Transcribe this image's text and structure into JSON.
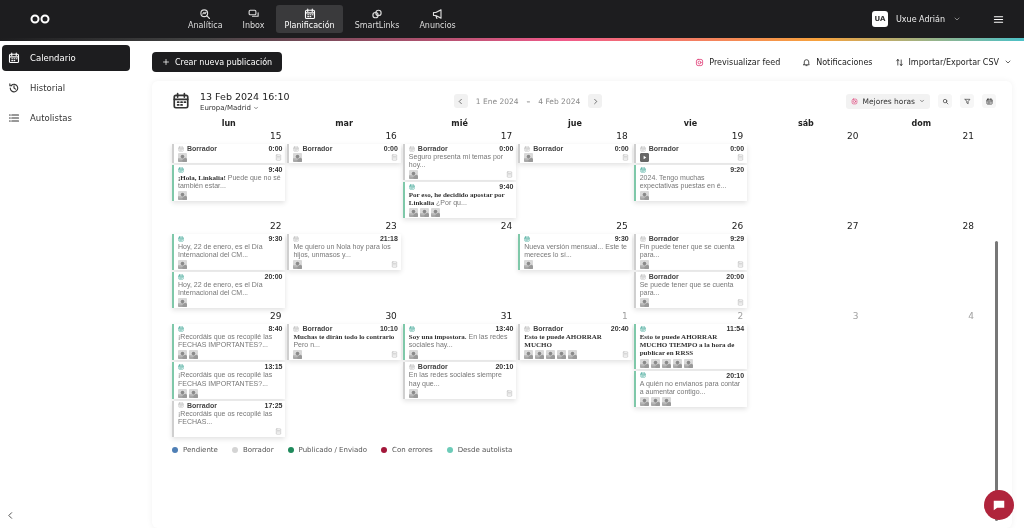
{
  "nav": {
    "tabs": [
      {
        "label": "Analítica",
        "selected": false
      },
      {
        "label": "Inbox",
        "selected": false
      },
      {
        "label": "Planificación",
        "selected": true
      },
      {
        "label": "SmartLinks",
        "selected": false
      },
      {
        "label": "Anuncios",
        "selected": false
      }
    ],
    "user": {
      "initials": "UA",
      "name": "Uxue Adrián"
    }
  },
  "sidebar": {
    "items": [
      {
        "label": "Calendario",
        "selected": true
      },
      {
        "label": "Historial",
        "selected": false
      },
      {
        "label": "Autolistas",
        "selected": false
      }
    ]
  },
  "toolbar": {
    "create_button": "Crear nueva publicación",
    "actions": [
      "Previsualizar feed",
      "Notificaciones",
      "Importar/Exportar CSV"
    ]
  },
  "calendar": {
    "datetime": "13 Feb 2024 16:10",
    "timezone": "Europa/Madrid",
    "range_start": "1 Ene 2024",
    "range_sep": "–",
    "range_end": "4 Feb 2024",
    "best_hours": "Mejores horas",
    "weekdays": [
      "lun",
      "mar",
      "mié",
      "jue",
      "vie",
      "sáb",
      "dom"
    ],
    "weeks": [
      {
        "days": [
          {
            "number": "15",
            "other_month": false,
            "posts": [
              {
                "time": "0:00",
                "kind": "draft",
                "label": "Borrador"
              },
              {
                "time": "9:40",
                "kind": "published",
                "text": "**¡Hola, Linkalia!** Puede que no sé también estar..."
              }
            ]
          },
          {
            "number": "16",
            "other_month": false,
            "posts": [
              {
                "time": "0:00",
                "kind": "draft",
                "label": "Borrador"
              }
            ]
          },
          {
            "number": "17",
            "other_month": false,
            "posts": [
              {
                "time": "0:00",
                "kind": "draft",
                "label": "Borrador",
                "text": "Seguro presenta mi temas por hoy..."
              },
              {
                "time": "9:40",
                "kind": "published",
                "text": "**Por eso, he decidido apostar por Linkalia** ¿Por qu..."
              }
            ]
          },
          {
            "number": "18",
            "other_month": false,
            "posts": [
              {
                "time": "0:00",
                "kind": "draft",
                "label": "Borrador"
              }
            ]
          },
          {
            "number": "19",
            "other_month": false,
            "posts": [
              {
                "time": "0:00",
                "kind": "draft",
                "label": "Borrador",
                "media": [
                  {
                    "kind": "video"
                  }
                ]
              },
              {
                "time": "9:20",
                "kind": "published",
                "text": "2024. Tengo muchas expectativas puestas en é..."
              }
            ]
          },
          {
            "number": "20",
            "other_month": false
          },
          {
            "number": "21",
            "other_month": false
          }
        ]
      },
      {
        "days": [
          {
            "number": "22",
            "other_month": false,
            "posts": [
              {
                "time": "9:30",
                "kind": "published",
                "text": "Hoy, 22 de enero, es el Día Internacional del CM..."
              },
              {
                "time": "20:00",
                "kind": "published",
                "text": "Hoy, 22 de enero, es el Día Internacional del CM..."
              }
            ]
          },
          {
            "number": "23",
            "other_month": false,
            "posts": [
              {
                "time": "21:18",
                "kind": "draft",
                "text": "Me quiero un Nola hoy para los hijos, unmasos y..."
              }
            ]
          },
          {
            "number": "24",
            "other_month": false
          },
          {
            "number": "25",
            "other_month": false,
            "posts": [
              {
                "time": "9:30",
                "kind": "published",
                "text": "Nueva versión mensual... Este te mereces lo sí..."
              }
            ]
          },
          {
            "number": "26",
            "other_month": false,
            "posts": [
              {
                "time": "9:29",
                "kind": "draft",
                "label": "Borrador",
                "text": "Fin puede tener que se cuenta para..."
              },
              {
                "time": "20:00",
                "kind": "draft",
                "label": "Borrador",
                "text": "Se puede tener que se cuenta para..."
              }
            ]
          },
          {
            "number": "27",
            "other_month": false
          },
          {
            "number": "28",
            "other_month": false
          }
        ]
      },
      {
        "days": [
          {
            "number": "29",
            "other_month": false,
            "posts": [
              {
                "time": "8:40",
                "kind": "published",
                "text": "¡Recordáis que os recopilé las FECHAS IMPORTANTES?..."
              },
              {
                "time": "13:15",
                "kind": "published",
                "text": "¡Recordáis que os recopilé las FECHAS IMPORTANTES?..."
              },
              {
                "time": "17:25",
                "kind": "draft",
                "label": "Borrador",
                "text": "¡Recordáis que os recopilé las FECHAS..."
              }
            ]
          },
          {
            "number": "30",
            "other_month": false,
            "posts": [
              {
                "time": "10:10",
                "kind": "draft",
                "label": "Borrador",
                "text": "**Muchas te dirán todo lo contrario** Pero n..."
              }
            ]
          },
          {
            "number": "31",
            "other_month": false,
            "posts": [
              {
                "time": "13:40",
                "kind": "published",
                "text": "**Soy una impostora.** En las redes sociales hay..."
              },
              {
                "time": "20:10",
                "kind": "draft",
                "label": "Borrador",
                "text": "En las redes sociales siempre hay que..."
              }
            ]
          },
          {
            "number": "1",
            "other_month": true,
            "posts": [
              {
                "time": "20:40",
                "kind": "draft",
                "label": "Borrador",
                "text": "**Esto te puede AHORRAR MUCHO**"
              }
            ]
          },
          {
            "number": "2",
            "other_month": true,
            "posts": [
              {
                "time": "11:54",
                "kind": "published",
                "text": "**Esto te puede AHORRAR MUCHO TIEMPO a la hora de publicar en RRSS**"
              },
              {
                "time": "20:10",
                "kind": "published",
                "text": "A quién no envianos para contar a aumentar contigo..."
              }
            ]
          },
          {
            "number": "3",
            "other_month": true
          },
          {
            "number": "4",
            "other_month": true
          }
        ]
      }
    ]
  },
  "legend": [
    {
      "label": "Pendiente",
      "color": "#4f7fb5"
    },
    {
      "label": "Borrador",
      "color": "#d4d4d4"
    },
    {
      "label": "Publicado / Enviado",
      "color": "#1f8a5c"
    },
    {
      "label": "Con errores",
      "color": "#a3173a"
    },
    {
      "label": "Desde autolista",
      "color": "#6ccbb8"
    }
  ]
}
